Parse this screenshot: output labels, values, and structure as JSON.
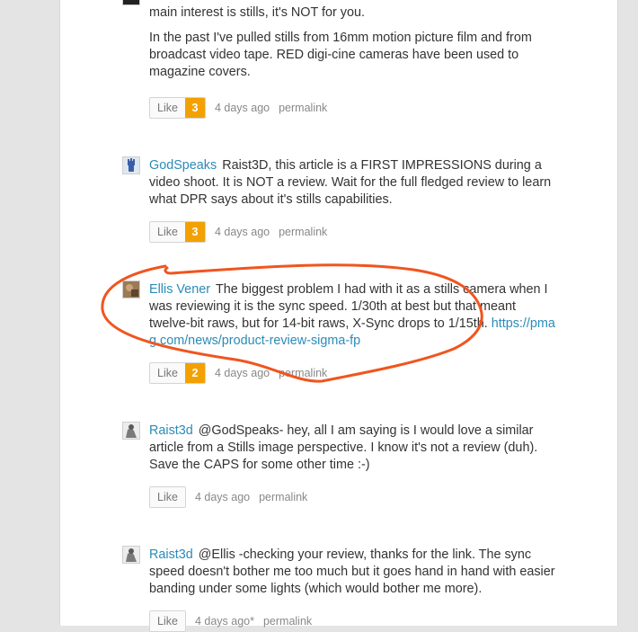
{
  "comments": [
    {
      "paragraphs": [
        "main interest is stills, it's NOT for you.",
        "In the past I've pulled stills from 16mm motion picture film and from broadcast video tape. RED digi-cine cameras have been used to magazine covers."
      ],
      "like_label": "Like",
      "likes": "3",
      "time": "4 days ago",
      "permalink": "permalink"
    },
    {
      "author": "GodSpeaks",
      "text": "Raist3D, this article is a FIRST IMPRESSIONS during a video shoot. It is NOT a review. Wait for the full fledged review to learn what DPR says about it's stills capabilities.",
      "like_label": "Like",
      "likes": "3",
      "time": "4 days ago",
      "permalink": "permalink"
    },
    {
      "author": "Ellis Vener",
      "text": "The biggest problem I had with it as a stills camera when I was reviewing it is the sync speed. 1/30th at best but that meant twelve-bit raws, but for 14-bit raws, X-Sync drops to 1/15th.",
      "link": "https://pmag.com/news/product-review-sigma-fp",
      "like_label": "Like",
      "likes": "2",
      "time": "4 days ago",
      "permalink": "permalink"
    },
    {
      "author": "Raist3d",
      "text": "@GodSpeaks- hey, all I am saying is I would love a similar article from a Stills image perspective. I know it's not a review (duh). Save the CAPS for some other time :-)",
      "like_label": "Like",
      "time": "4 days ago",
      "permalink": "permalink"
    },
    {
      "author": "Raist3d",
      "text": "@Ellis -checking your review, thanks for the link. The sync speed doesn't bother me too much but it goes hand in hand with easier banding under some lights (which would bother me more).",
      "like_label": "Like",
      "time": "4 days ago*",
      "permalink": "permalink"
    }
  ],
  "colors": {
    "author_link": "#2b8bb8",
    "like_count_bg": "#f3a100",
    "annotation": "#f0551e"
  }
}
